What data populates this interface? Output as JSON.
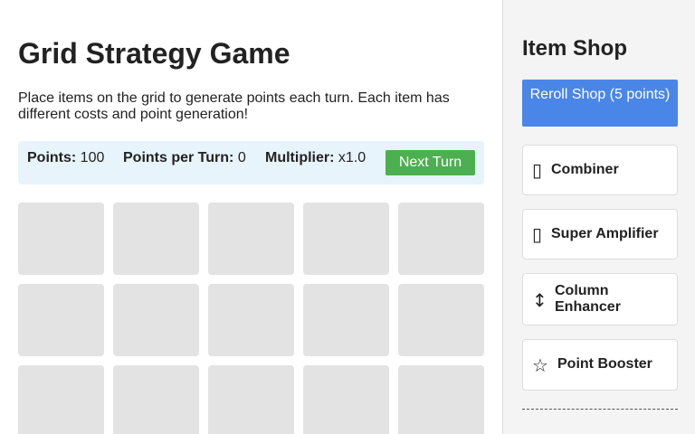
{
  "game": {
    "title": "Grid Strategy Game",
    "description": "Place items on the grid to generate points each turn. Each item has different costs and point generation!"
  },
  "status": {
    "points_label": "Points:",
    "points_value": "100",
    "ppt_label": "Points per Turn:",
    "ppt_value": "0",
    "multiplier_label": "Multiplier:",
    "multiplier_value": "x1.0",
    "next_turn_label": "Next Turn"
  },
  "shop": {
    "title": "Item Shop",
    "reroll_label": "Reroll Shop (5 points)",
    "items": [
      {
        "icon": "combiner-icon",
        "glyph": "▯",
        "label": "Combiner"
      },
      {
        "icon": "super-amplifier-icon",
        "glyph": "▯",
        "label": "Super Amplifier"
      },
      {
        "icon": "up-down-arrow-icon",
        "glyph": "↕",
        "label": "Column Enhancer"
      },
      {
        "icon": "star-icon",
        "glyph": "☆",
        "label": "Point Booster"
      }
    ]
  },
  "colors": {
    "next_turn": "#4caf50",
    "reroll": "#4a86e8",
    "status_bg": "#e8f4fc",
    "cell": "#e3e3e3"
  }
}
